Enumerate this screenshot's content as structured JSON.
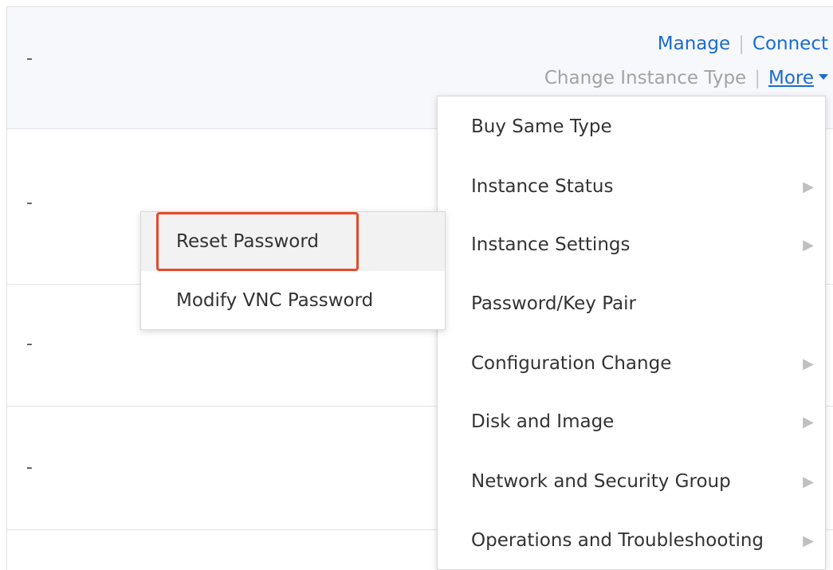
{
  "table": {
    "rows": [
      {
        "placeholder": "-"
      },
      {
        "placeholder": "-"
      },
      {
        "placeholder": "-"
      },
      {
        "placeholder": "-"
      }
    ]
  },
  "actions": {
    "manage": "Manage",
    "connect": "Connect",
    "separator": "|",
    "change_instance_type": "Change Instance Type",
    "more": "More"
  },
  "more_menu": {
    "items": [
      {
        "label": "Buy Same Type",
        "has_submenu": false
      },
      {
        "label": "Instance Status",
        "has_submenu": true
      },
      {
        "label": "Instance Settings",
        "has_submenu": true
      },
      {
        "label": "Password/Key Pair",
        "has_submenu": false
      },
      {
        "label": "Configuration Change",
        "has_submenu": true
      },
      {
        "label": "Disk and Image",
        "has_submenu": true
      },
      {
        "label": "Network and Security Group",
        "has_submenu": true
      },
      {
        "label": "Operations and Troubleshooting",
        "has_submenu": true
      }
    ]
  },
  "password_submenu": {
    "items": [
      {
        "label": "Reset Password"
      },
      {
        "label": "Modify VNC Password"
      }
    ]
  },
  "colors": {
    "link": "#1a6bd1",
    "highlight": "#e8492b",
    "muted": "#a3a3a3"
  }
}
